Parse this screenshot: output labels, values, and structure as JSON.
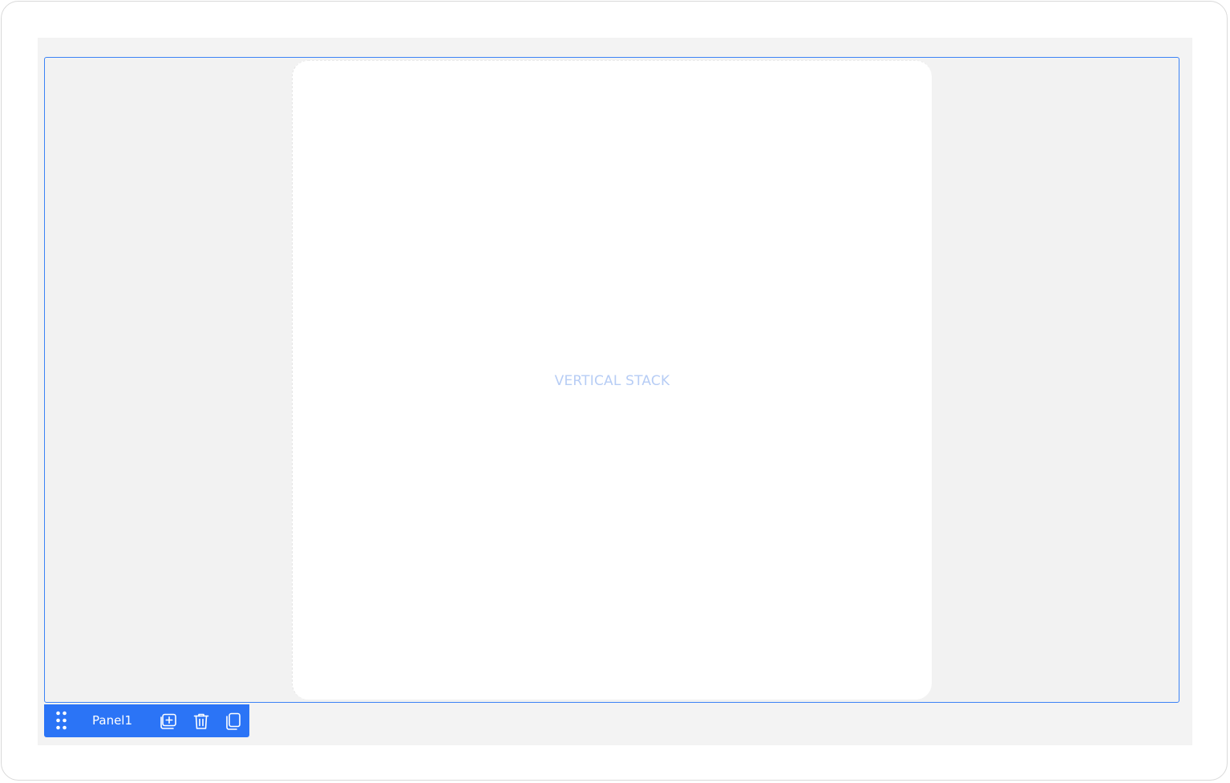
{
  "canvas": {
    "vertical_stack_label": "VERTICAL STACK"
  },
  "panel": {
    "name": "Panel1"
  },
  "toolbar": {
    "icons": [
      "drag-handle-icon",
      "add-panel-icon",
      "trash-icon",
      "duplicate-icon"
    ]
  },
  "colors": {
    "accent": "#2b74f6",
    "placeholder_text": "#b7cdf5",
    "canvas_background": "#f3f3f3"
  }
}
